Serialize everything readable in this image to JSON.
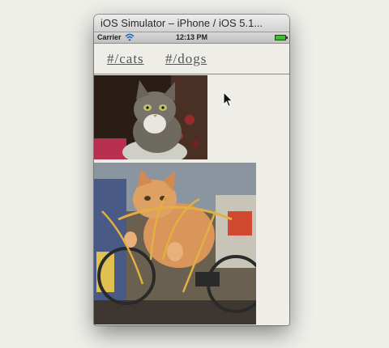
{
  "window": {
    "title": "iOS Simulator – iPhone / iOS 5.1..."
  },
  "statusbar": {
    "carrier": "Carrier",
    "time": "12:13 PM"
  },
  "nav": {
    "links": [
      "#/cats",
      "#/dogs"
    ]
  },
  "colors": {
    "page_bg": "#efefea",
    "content_bg": "#eeede8",
    "link": "#555555",
    "battery": "#3bbf2b"
  },
  "icons": {
    "wifi": "wifi-icon",
    "battery": "battery-icon",
    "cursor": "mouse-pointer-icon"
  }
}
